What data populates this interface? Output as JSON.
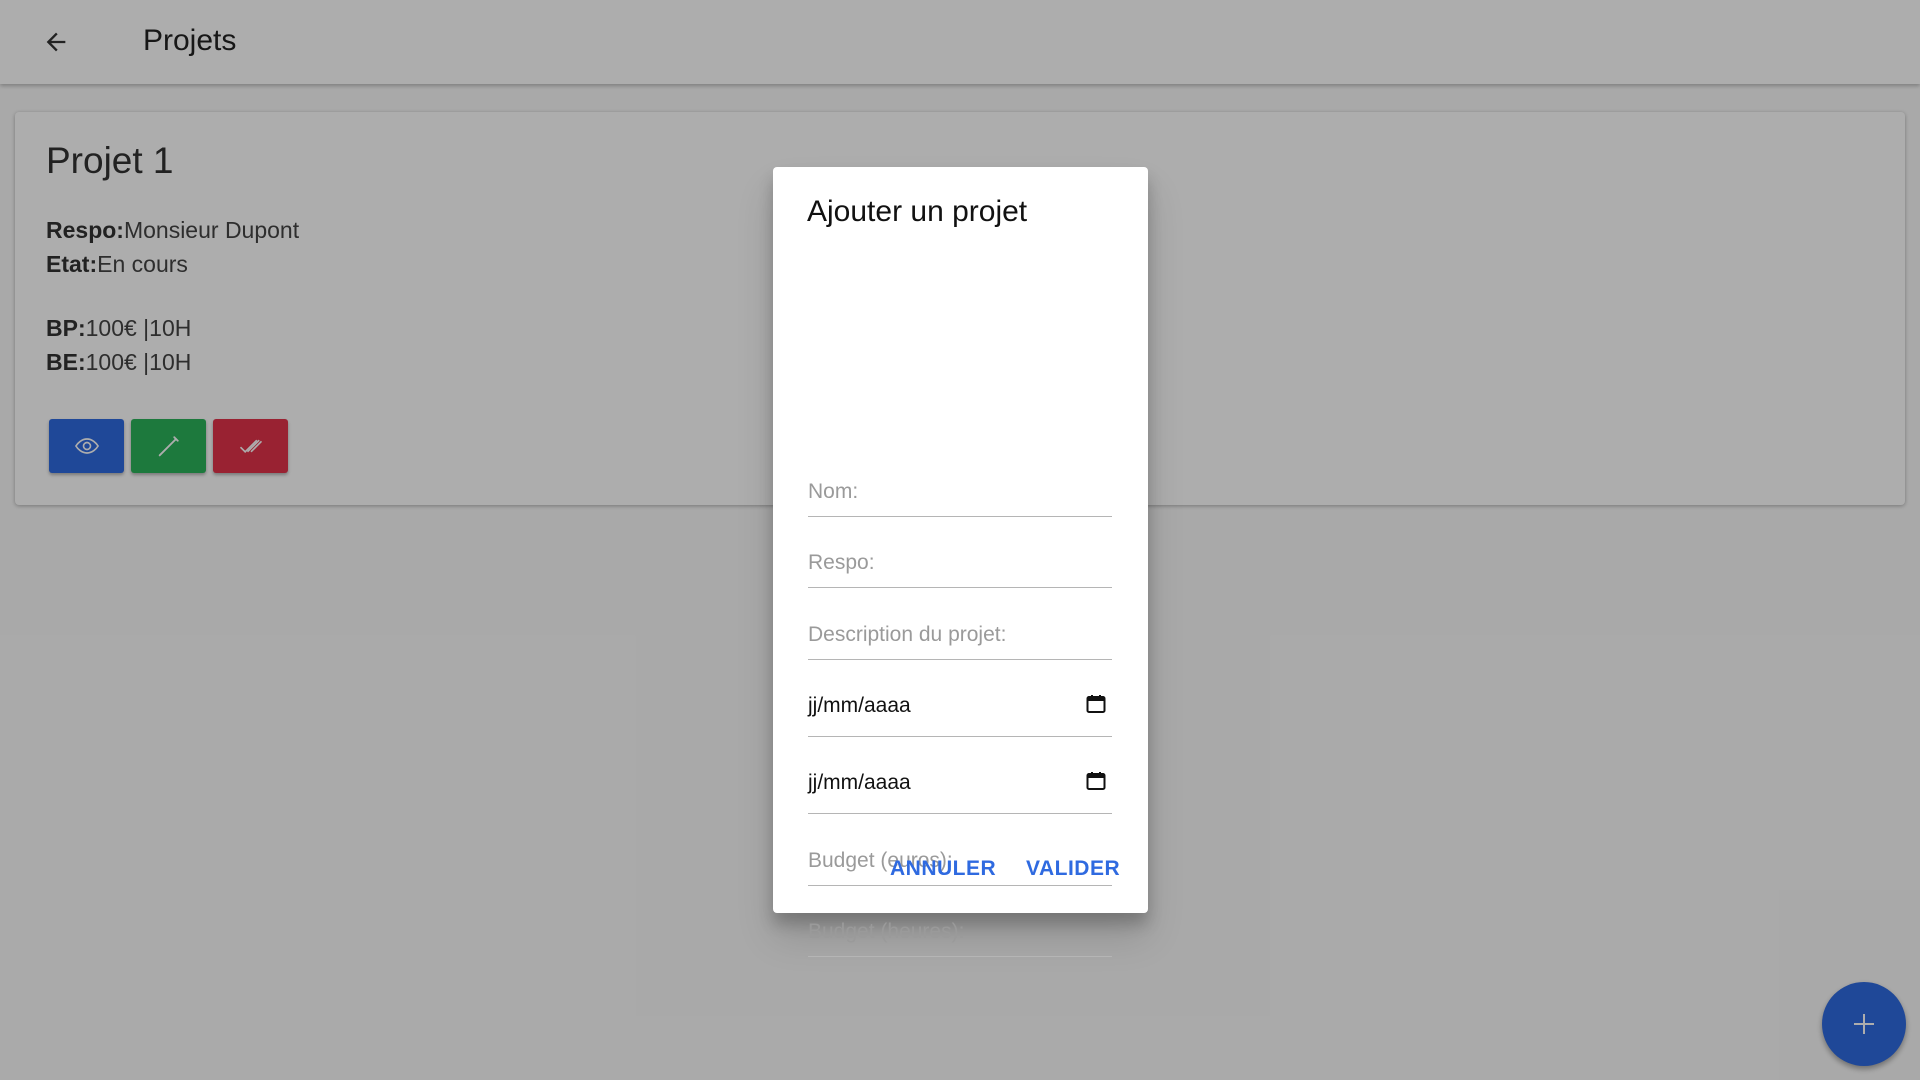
{
  "appbar": {
    "title": "Projets",
    "back_icon": "arrow-left-icon"
  },
  "card": {
    "title": "Projet 1",
    "respo_label": "Respo:",
    "respo_value": "Monsieur Dupont",
    "etat_label": "Etat:",
    "etat_value": "En cours",
    "bp_label": "BP:",
    "bp_value": "100€ |10H",
    "be_label": "BE:",
    "be_value": "100€ |10H",
    "actions": {
      "view": {
        "icon": "eye-icon",
        "color": "#2f6ae0"
      },
      "edit": {
        "icon": "pencil-icon",
        "color": "#2bb35a"
      },
      "done": {
        "icon": "double-check-icon",
        "color": "#e2334b"
      }
    }
  },
  "dialog": {
    "title": "Ajouter un projet",
    "fields": {
      "nom": {
        "placeholder": "Nom:",
        "value": ""
      },
      "respo": {
        "placeholder": "Respo:",
        "value": ""
      },
      "description": {
        "placeholder": "Description du projet:",
        "value": ""
      },
      "date_start": {
        "display": "jj/mm/aaaa"
      },
      "date_end": {
        "display": "jj/mm/aaaa"
      },
      "budget_euros": {
        "placeholder": "Budget (euros):",
        "value": ""
      },
      "budget_heures": {
        "placeholder": "Budget (heures):",
        "value": ""
      }
    },
    "cancel_label": "ANNULER",
    "submit_label": "VALIDER"
  },
  "fab": {
    "icon": "plus-icon",
    "color": "#2f6ae0"
  },
  "colors": {
    "primary": "#2f6ae0",
    "success": "#2bb35a",
    "danger": "#e2334b"
  }
}
